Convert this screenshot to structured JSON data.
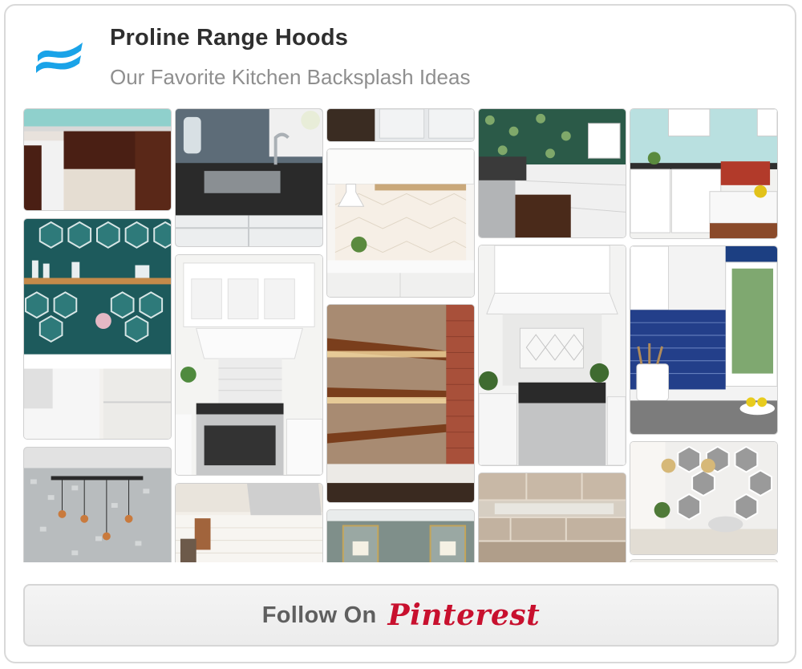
{
  "profile": {
    "name": "Proline Range Hoods",
    "board_title": "Our Favorite Kitchen Backsplash Ideas",
    "logo_icon": "wave-logo-icon",
    "logo_color": "#1aa3e8"
  },
  "follow": {
    "label": "Follow On",
    "brand": "Pinterest",
    "brand_color": "#c8102e"
  }
}
